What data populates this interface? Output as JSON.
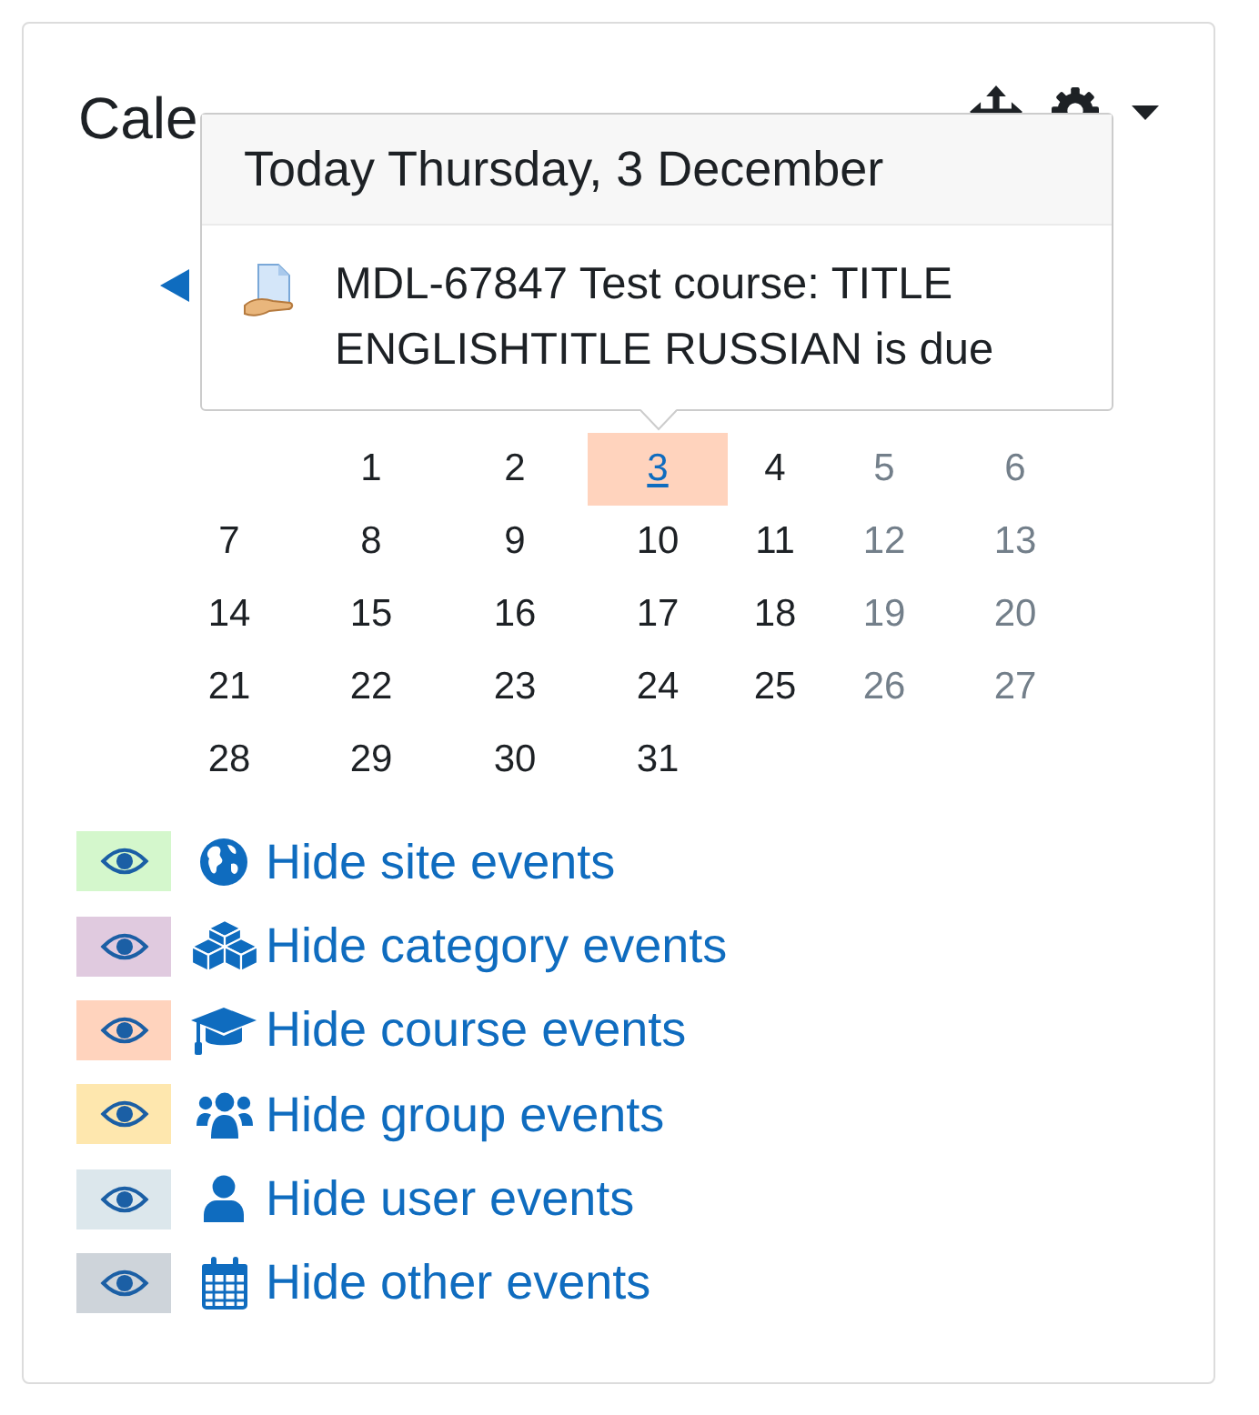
{
  "block": {
    "title": "Cale"
  },
  "popover": {
    "title": "Today Thursday, 3 December",
    "events": [
      {
        "kind": "assignment",
        "text": "MDL-67847 Test course: TITLE ENGLISHTITLE RUSSIAN is due"
      }
    ]
  },
  "calendar": {
    "weeks": [
      [
        {
          "label": "1",
          "weekend": false,
          "has_event": false
        },
        {
          "label": "2",
          "weekend": false,
          "has_event": false
        },
        {
          "label": "3",
          "weekend": false,
          "has_event": true,
          "color": "#ffd3bd"
        },
        {
          "label": "4",
          "weekend": false,
          "has_event": false
        },
        {
          "label": "5",
          "weekend": true,
          "has_event": false
        },
        {
          "label": "6",
          "weekend": true,
          "has_event": false
        }
      ],
      [
        {
          "label": "7",
          "weekend": false,
          "has_event": false
        },
        {
          "label": "8",
          "weekend": false,
          "has_event": false
        },
        {
          "label": "9",
          "weekend": false,
          "has_event": false
        },
        {
          "label": "10",
          "weekend": false,
          "has_event": false
        },
        {
          "label": "11",
          "weekend": false,
          "has_event": false
        },
        {
          "label": "12",
          "weekend": true,
          "has_event": false
        },
        {
          "label": "13",
          "weekend": true,
          "has_event": false
        }
      ],
      [
        {
          "label": "14",
          "weekend": false,
          "has_event": false
        },
        {
          "label": "15",
          "weekend": false,
          "has_event": false
        },
        {
          "label": "16",
          "weekend": false,
          "has_event": false
        },
        {
          "label": "17",
          "weekend": false,
          "has_event": false
        },
        {
          "label": "18",
          "weekend": false,
          "has_event": false
        },
        {
          "label": "19",
          "weekend": true,
          "has_event": false
        },
        {
          "label": "20",
          "weekend": true,
          "has_event": false
        }
      ],
      [
        {
          "label": "21",
          "weekend": false,
          "has_event": false
        },
        {
          "label": "22",
          "weekend": false,
          "has_event": false
        },
        {
          "label": "23",
          "weekend": false,
          "has_event": false
        },
        {
          "label": "24",
          "weekend": false,
          "has_event": false
        },
        {
          "label": "25",
          "weekend": false,
          "has_event": false
        },
        {
          "label": "26",
          "weekend": true,
          "has_event": false
        },
        {
          "label": "27",
          "weekend": true,
          "has_event": false
        }
      ],
      [
        {
          "label": "28",
          "weekend": false,
          "has_event": false
        },
        {
          "label": "29",
          "weekend": false,
          "has_event": false
        },
        {
          "label": "30",
          "weekend": false,
          "has_event": false
        },
        {
          "label": "31",
          "weekend": false,
          "has_event": false
        }
      ]
    ]
  },
  "legend": [
    {
      "kind": "site",
      "label": "Hide site events",
      "color": "#d4f7cc"
    },
    {
      "kind": "category",
      "label": "Hide category events",
      "color": "#e0cadf"
    },
    {
      "kind": "course",
      "label": "Hide course events",
      "color": "#ffd3bd"
    },
    {
      "kind": "group",
      "label": "Hide group events",
      "color": "#fee7ae"
    },
    {
      "kind": "user",
      "label": "Hide user events",
      "color": "#dce7ec"
    },
    {
      "kind": "other",
      "label": "Hide other events",
      "color": "#ced4da"
    }
  ]
}
